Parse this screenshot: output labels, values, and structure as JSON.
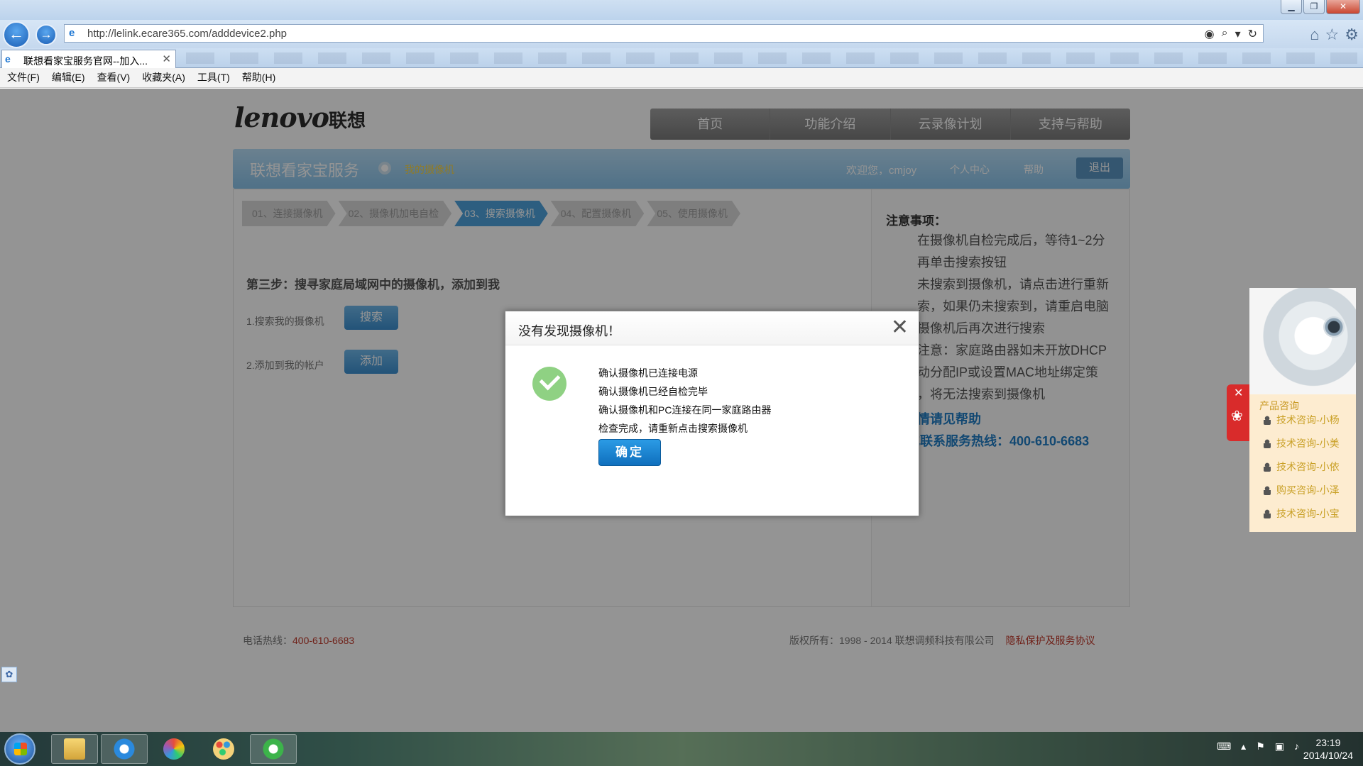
{
  "browser": {
    "url": "http://lelink.ecare365.com/adddevice2.php",
    "tab_title": "联想看家宝服务官网--加入...",
    "menu": [
      "文件(F)",
      "编辑(E)",
      "查看(V)",
      "收藏夹(A)",
      "工具(T)",
      "帮助(H)"
    ]
  },
  "site": {
    "logo_text": "lenovo",
    "logo_cn": "联想",
    "nav": [
      "首页",
      "功能介绍",
      "云录像计划",
      "支持与帮助"
    ],
    "service_title": "联想看家宝服务",
    "my_cameras": "我的摄像机",
    "welcome": "欢迎您，cmjoy",
    "personal_center": "个人中心",
    "help": "帮助",
    "logout": "退出"
  },
  "steps": [
    "01、连接摄像机",
    "02、摄像机加电自检",
    "03、搜索摄像机",
    "04、配置摄像机",
    "05、使用摄像机"
  ],
  "active_step_index": 2,
  "main": {
    "heading": "第三步：搜寻家庭局域网中的摄像机，添加到我",
    "row1_label": "1.搜索我的摄像机",
    "row1_button": "搜索",
    "row2_label": "2.添加到我的帐户",
    "row2_button": "添加"
  },
  "notes": {
    "title": "注意事项：",
    "lines": [
      "在摄像机自检完成后，等待1~2分",
      "再单击搜索按钮",
      "未搜索到摄像机，请点击进行重新",
      "索，如果仍未搜索到，请重启电脑",
      "摄像机后再次进行搜索",
      "注意：家庭路由器如未开放DHCP",
      "动分配IP或设置MAC地址绑定策",
      "，将无法搜索到摄像机"
    ],
    "help_link": "情请见帮助",
    "hotline": "或联系服务热线：400-610-6683"
  },
  "footer": {
    "hotline_label": "电话热线：",
    "hotline_number": "400-610-6683",
    "copyright": "版权所有：1998 - 2014 联想调频科技有限公司",
    "privacy": "隐私保护及服务协议"
  },
  "chat": {
    "title": "产品咨询",
    "items": [
      "技术咨询-小杨",
      "技术咨询-小美",
      "技术咨询-小依",
      "购买咨询-小泽",
      "技术咨询-小宝"
    ]
  },
  "dialog": {
    "title": "没有发现摄像机！",
    "lines": [
      "确认摄像机已连接电源",
      "确认摄像机已经自检完毕",
      "确认摄像机和PC连接在同一家庭路由器",
      "检查完成，请重新点击搜索摄像机"
    ],
    "confirm": "确定"
  },
  "taskbar": {
    "time": "23:19",
    "date": "2014/10/24"
  }
}
